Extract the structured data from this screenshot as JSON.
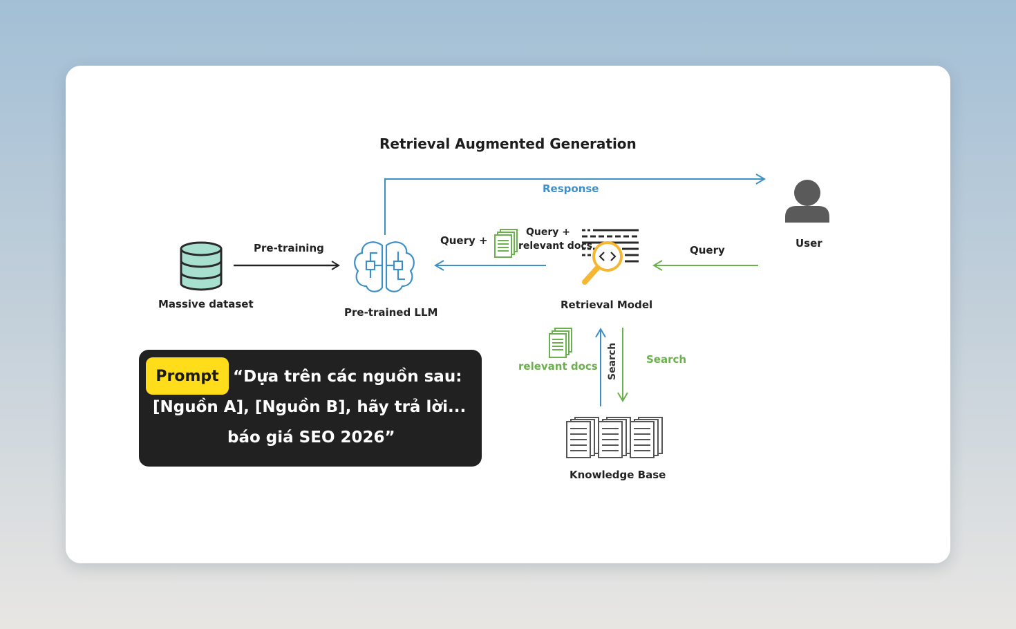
{
  "diagram": {
    "title": "Retrieval Augmented Generation",
    "nodes": {
      "dataset": "Massive dataset",
      "llm": "Pre-trained LLM",
      "retrieval_model": "Retrieval Model",
      "user": "User",
      "knowledge_base": "Knowledge Base"
    },
    "edges": {
      "pretraining": "Pre-training",
      "response": "Response",
      "query_plus": "Query  +",
      "query_docs_line1": "Query  +",
      "query_docs_line2": "relevant docs",
      "user_query": "Query",
      "relevant_docs": "relevant docs",
      "search_up": "Search",
      "search_down": "Search"
    }
  },
  "prompt": {
    "badge": "Prompt",
    "line1": "“Dựa trên các nguồn sau:",
    "line2": "[Nguồn A], [Nguồn B], hãy trả lời...",
    "line3": "báo giá SEO 2026”"
  },
  "colors": {
    "blue": "#3d8fc7",
    "green": "#6ab04c",
    "database": "#a8e0cf",
    "badge": "#ffdd1a",
    "prompt_bg": "#212121"
  }
}
